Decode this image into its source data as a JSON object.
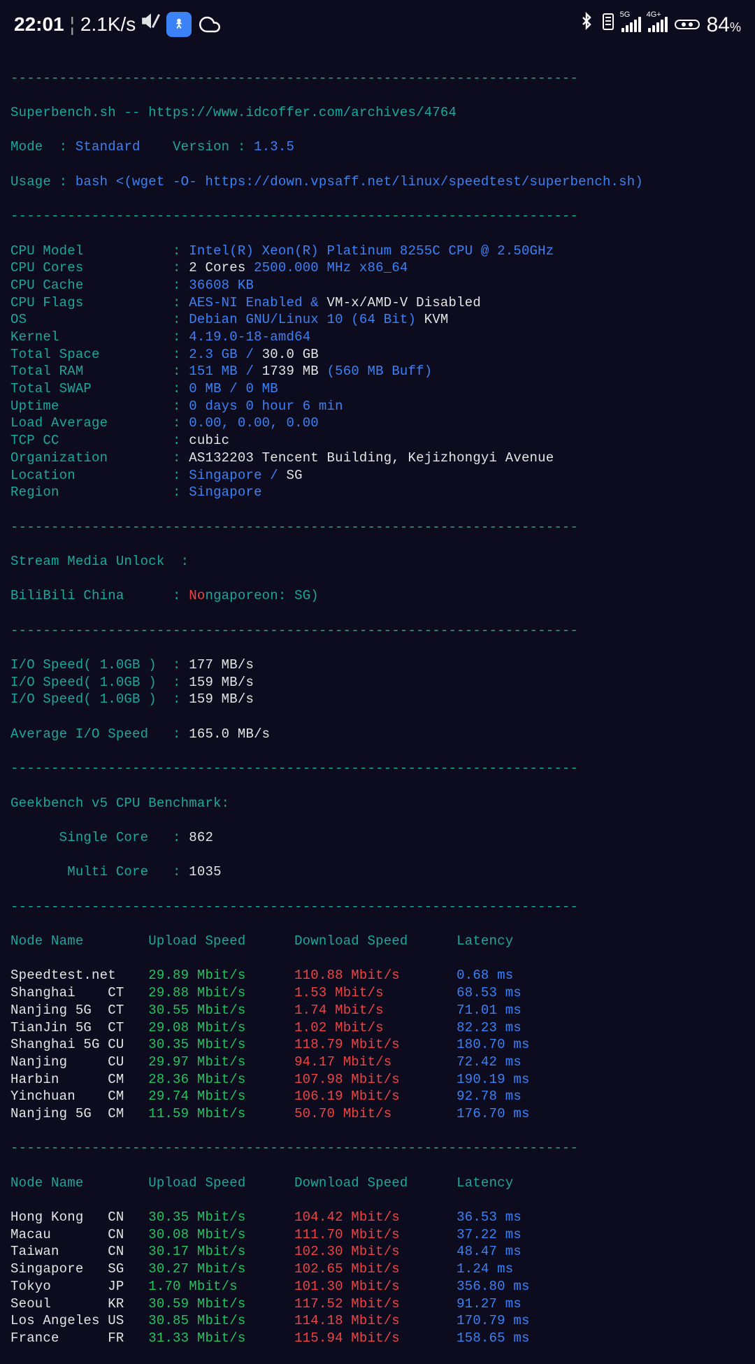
{
  "status": {
    "time": "22:01",
    "net_speed": "2.1K/s",
    "signal1_label": "5G",
    "signal2_label": "4G+",
    "battery": "84",
    "battery_unit": "%"
  },
  "dividers": {
    "long": "----------------------------------------------------------------------",
    "med": "----------------------------------------------------------------------"
  },
  "header": {
    "title": "Superbench.sh -- https://www.idcoffer.com/archives/4764",
    "mode_label": "Mode  : ",
    "mode_value": "Standard",
    "version_label": "    Version : ",
    "version_value": "1.3.5",
    "usage_label": "Usage : ",
    "usage_value": "bash <(wget -O- https://down.vpsaff.net/linux/speedtest/superbench.sh)"
  },
  "sysinfo": [
    {
      "label": "CPU Model           ",
      "v1": "Intel(R) Xeon(R) Platinum 8255C CPU @ 2.50GHz",
      "c1": "blue"
    },
    {
      "label": "CPU Cores           ",
      "v1": "2 Cores ",
      "c1": "white",
      "v2": "2500.000 MHz x86_64",
      "c2": "blue"
    },
    {
      "label": "CPU Cache           ",
      "v1": "36608 KB",
      "c1": "blue"
    },
    {
      "label": "CPU Flags           ",
      "v1": "AES-NI Enabled & ",
      "c1": "blue",
      "v2": "VM-x/AMD-V Disabled",
      "c2": "white"
    },
    {
      "label": "OS                  ",
      "v1": "Debian GNU/Linux 10 (64 Bit)",
      "c1": "blue",
      "v2": " KVM",
      "c2": "white"
    },
    {
      "label": "Kernel              ",
      "v1": "4.19.0-18-amd64",
      "c1": "blue"
    },
    {
      "label": "Total Space         ",
      "v1": "2.3 GB / ",
      "c1": "blue",
      "v2": "30.0 GB",
      "c2": "white"
    },
    {
      "label": "Total RAM           ",
      "v1": "151 MB / ",
      "c1": "blue",
      "v2": "1739 MB ",
      "c2": "white",
      "v3": "(560 MB Buff)",
      "c3": "blue"
    },
    {
      "label": "Total SWAP          ",
      "v1": "0 MB / 0 MB",
      "c1": "blue"
    },
    {
      "label": "Uptime              ",
      "v1": "0 days 0 hour 6 min",
      "c1": "blue"
    },
    {
      "label": "Load Average        ",
      "v1": "0.00, 0.00, 0.00",
      "c1": "blue"
    },
    {
      "label": "TCP CC              ",
      "v1": "cubic",
      "c1": "white"
    },
    {
      "label": "Organization        ",
      "v1": "AS132203 Tencent Building, Kejizhongyi Avenue",
      "c1": "white"
    },
    {
      "label": "Location            ",
      "v1": "Singapore / ",
      "c1": "blue",
      "v2": "SG",
      "c2": "white"
    },
    {
      "label": "Region              ",
      "v1": "Singapore",
      "c1": "blue"
    }
  ],
  "stream": {
    "header": "Stream Media Unlock  :",
    "bilibili_label": "BiliBili China      : ",
    "bilibili_no": "No",
    "bilibili_rest": "ngaporeon: SG)"
  },
  "io": {
    "tests": [
      {
        "label": "I/O Speed( 1.0GB )  ",
        "value": "177 MB/s"
      },
      {
        "label": "I/O Speed( 1.0GB )  ",
        "value": "159 MB/s"
      },
      {
        "label": "I/O Speed( 1.0GB )  ",
        "value": "159 MB/s"
      }
    ],
    "avg_label": "Average I/O Speed   ",
    "avg_value": "165.0 MB/s"
  },
  "geekbench": {
    "title": "Geekbench v5 CPU Benchmark:",
    "single_label": "      Single Core   ",
    "single_value": "862",
    "multi_label": "       Multi Core   ",
    "multi_value": "1035"
  },
  "speedtest": {
    "header": {
      "node": "Node Name        ",
      "upload": "Upload Speed      ",
      "download": "Download Speed      ",
      "latency": "Latency"
    },
    "rows": [
      {
        "name": "Speedtest.net    ",
        "up": "29.89 Mbit/s      ",
        "down": "110.88 Mbit/s       ",
        "lat": "0.68 ms"
      },
      {
        "name": "Shanghai    CT   ",
        "up": "29.88 Mbit/s      ",
        "down": "1.53 Mbit/s         ",
        "lat": "68.53 ms"
      },
      {
        "name": "Nanjing 5G  CT   ",
        "up": "30.55 Mbit/s      ",
        "down": "1.74 Mbit/s         ",
        "lat": "71.01 ms"
      },
      {
        "name": "TianJin 5G  CT   ",
        "up": "29.08 Mbit/s      ",
        "down": "1.02 Mbit/s         ",
        "lat": "82.23 ms"
      },
      {
        "name": "Shanghai 5G CU   ",
        "up": "30.35 Mbit/s      ",
        "down": "118.79 Mbit/s       ",
        "lat": "180.70 ms"
      },
      {
        "name": "Nanjing     CU   ",
        "up": "29.97 Mbit/s      ",
        "down": "94.17 Mbit/s        ",
        "lat": "72.42 ms"
      },
      {
        "name": "Harbin      CM   ",
        "up": "28.36 Mbit/s      ",
        "down": "107.98 Mbit/s       ",
        "lat": "190.19 ms"
      },
      {
        "name": "Yinchuan    CM   ",
        "up": "29.74 Mbit/s      ",
        "down": "106.19 Mbit/s       ",
        "lat": "92.78 ms"
      },
      {
        "name": "Nanjing 5G  CM   ",
        "up": "11.59 Mbit/s      ",
        "down": "50.70 Mbit/s        ",
        "lat": "176.70 ms"
      }
    ],
    "rows2": [
      {
        "name": "Hong Kong   CN   ",
        "up": "30.35 Mbit/s      ",
        "down": "104.42 Mbit/s       ",
        "lat": "36.53 ms"
      },
      {
        "name": "Macau       CN   ",
        "up": "30.08 Mbit/s      ",
        "down": "111.70 Mbit/s       ",
        "lat": "37.22 ms"
      },
      {
        "name": "Taiwan      CN   ",
        "up": "30.17 Mbit/s      ",
        "down": "102.30 Mbit/s       ",
        "lat": "48.47 ms"
      },
      {
        "name": "Singapore   SG   ",
        "up": "30.27 Mbit/s      ",
        "down": "102.65 Mbit/s       ",
        "lat": "1.24 ms"
      },
      {
        "name": "Tokyo       JP   ",
        "up": "1.70 Mbit/s       ",
        "down": "101.30 Mbit/s       ",
        "lat": "356.80 ms"
      },
      {
        "name": "Seoul       KR   ",
        "up": "30.59 Mbit/s      ",
        "down": "117.52 Mbit/s       ",
        "lat": "91.27 ms"
      },
      {
        "name": "Los Angeles US   ",
        "up": "30.85 Mbit/s      ",
        "down": "114.18 Mbit/s       ",
        "lat": "170.79 ms"
      },
      {
        "name": "France      FR   ",
        "up": "31.33 Mbit/s      ",
        "down": "115.94 Mbit/s       ",
        "lat": "158.65 ms"
      }
    ]
  }
}
